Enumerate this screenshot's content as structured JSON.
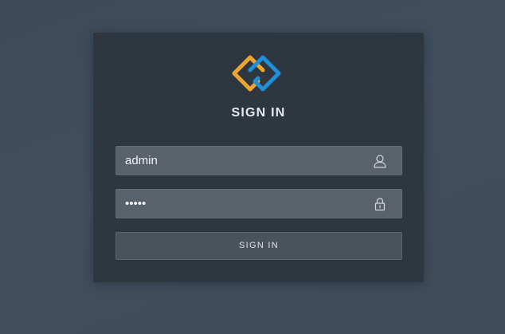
{
  "login": {
    "title": "SIGN IN",
    "username": {
      "value": "admin",
      "icon": "user-icon"
    },
    "password": {
      "value": "admin",
      "icon": "lock-icon"
    },
    "submit_label": "SIGN IN"
  },
  "colors": {
    "logo_orange": "#f0a530",
    "logo_blue": "#1f8fd6",
    "card_bg": "#2e3640",
    "field_bg": "#59616b"
  }
}
